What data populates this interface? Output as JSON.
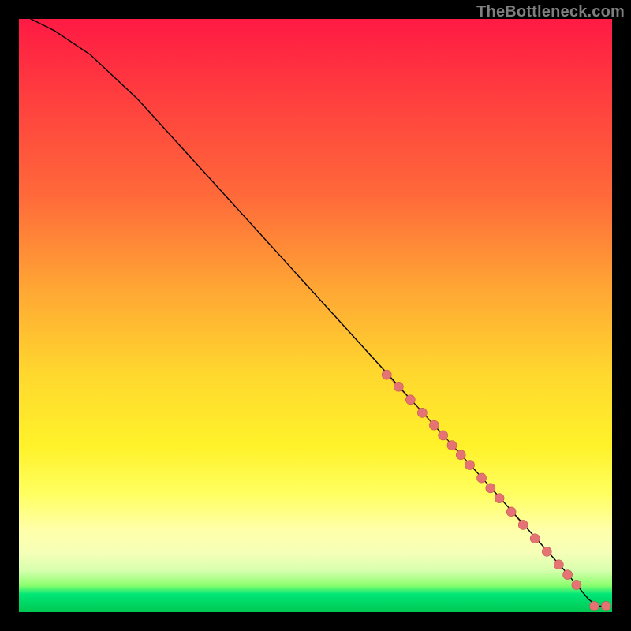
{
  "watermark": "TheBottleneck.com",
  "chart_data": {
    "type": "line",
    "title": "",
    "xlabel": "",
    "ylabel": "",
    "xlim": [
      0,
      100
    ],
    "ylim": [
      0,
      100
    ],
    "curve": {
      "name": "bottleneck-curve",
      "x": [
        2,
        6,
        12,
        20,
        30,
        40,
        50,
        60,
        70,
        80,
        88,
        92,
        94.5,
        96,
        97.5,
        99
      ],
      "y": [
        100,
        98,
        94,
        86.5,
        75.5,
        64.5,
        53.5,
        42.5,
        31.5,
        20.5,
        11.5,
        7,
        4,
        2.2,
        1.0,
        1.0
      ]
    },
    "points": {
      "name": "highlighted-range",
      "x": [
        62,
        64,
        66,
        68,
        70,
        71.5,
        73,
        74.5,
        76,
        78,
        79.5,
        81,
        83,
        85,
        87,
        89,
        91,
        92.5,
        94,
        97,
        99
      ],
      "y": [
        40,
        38,
        35.8,
        33.6,
        31.5,
        29.8,
        28.1,
        26.5,
        24.8,
        22.6,
        20.9,
        19.2,
        16.9,
        14.7,
        12.4,
        10.2,
        8.0,
        6.3,
        4.6,
        1.0,
        1.0
      ]
    },
    "pills": [
      {
        "x0": 62,
        "y0": 40,
        "x1": 70,
        "y1": 31.5
      },
      {
        "x0": 71.5,
        "y0": 29.8,
        "x1": 76,
        "y1": 24.8
      },
      {
        "x0": 78,
        "y0": 22.6,
        "x1": 81,
        "y1": 19.2
      },
      {
        "x0": 83,
        "y0": 16.9,
        "x1": 85,
        "y1": 14.7
      }
    ],
    "gradient_stops": [
      {
        "pos": 0.0,
        "color": "#ff1a44"
      },
      {
        "pos": 0.3,
        "color": "#ff6a3a"
      },
      {
        "pos": 0.6,
        "color": "#ffd82e"
      },
      {
        "pos": 0.86,
        "color": "#ffffa8"
      },
      {
        "pos": 0.97,
        "color": "#00e676"
      },
      {
        "pos": 1.0,
        "color": "#00c853"
      }
    ]
  }
}
